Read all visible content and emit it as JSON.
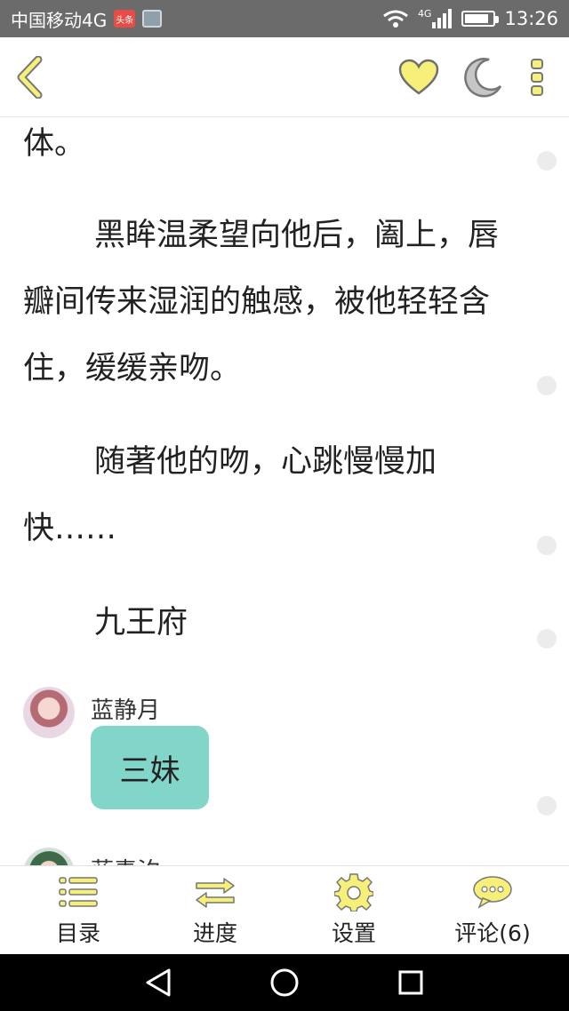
{
  "status_bar": {
    "carrier": "中国移动4G",
    "toutiao_badge": "头条",
    "network": "4G",
    "time": "13:26",
    "battery_level": 0.85
  },
  "top_bar": {
    "icons": [
      "back-icon",
      "heart-icon",
      "moon-icon",
      "more-icon"
    ],
    "accent_color": "#f6ef7a"
  },
  "content": {
    "paragraphs": [
      "体。",
      "黑眸温柔望向他后，阖上，唇瓣间传来湿润的触感，被他轻轻含住，缓缓亲吻。",
      "随著他的吻，心跳慢慢加快……",
      "九王府"
    ],
    "chat": [
      {
        "speaker": "蓝静月",
        "message": "三妹"
      },
      {
        "speaker": "蓝素汐"
      }
    ],
    "bubble_color": "#82d5c9"
  },
  "bottom_bar": {
    "tabs": [
      {
        "label": "目录",
        "icon": "catalog-icon"
      },
      {
        "label": "进度",
        "icon": "progress-icon"
      },
      {
        "label": "设置",
        "icon": "gear-icon"
      },
      {
        "label": "评论(6)",
        "icon": "comment-icon"
      }
    ]
  },
  "nav_bar": {
    "icons": [
      "back-triangle-icon",
      "home-circle-icon",
      "recents-square-icon"
    ]
  }
}
